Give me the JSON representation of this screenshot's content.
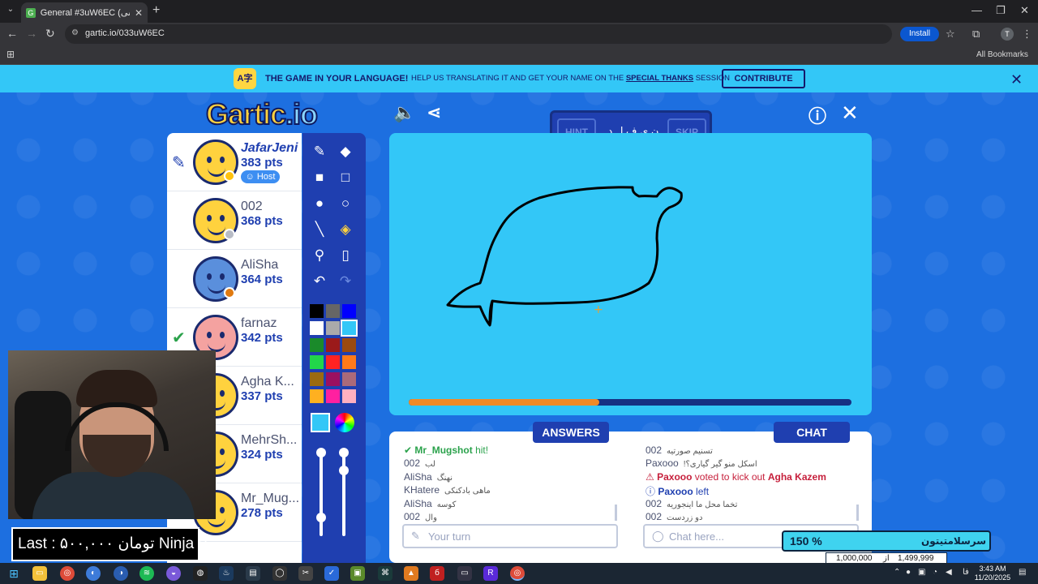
{
  "browser": {
    "tab_title": "General #3uW6EC (فارسی) - Gar",
    "url": "gartic.io/033uW6EC",
    "install_label": "Install",
    "bookmarks_label": "All Bookmarks",
    "profile_initial": "T"
  },
  "banner": {
    "headline": "THE GAME IN YOUR LANGUAGE!",
    "text_before": "HELP US TRANSLATING IT AND GET YOUR NAME ON THE",
    "link": "SPECIAL THANKS",
    "text_after": "SESSION",
    "contribute_label": "CONTRIBUTE"
  },
  "game": {
    "logo_main": "Gartic",
    "logo_tld": ".io",
    "hint_label": "HINT",
    "skip_label": "SKIP",
    "word_pattern": "ن ی ف ل د",
    "time_progress": 0.43
  },
  "players": [
    {
      "name": "JafarJeni",
      "points": "383 pts",
      "host_label": "Host",
      "status_color": "#ffc20e",
      "drawing": true
    },
    {
      "name": "002",
      "points": "368 pts",
      "status_color": "#b8bcc6"
    },
    {
      "name": "AliSha",
      "points": "364 pts",
      "status_color": "#e07a10"
    },
    {
      "name": "farnaz",
      "points": "342 pts",
      "guessed": true
    },
    {
      "name": "Agha K...",
      "points": "337 pts"
    },
    {
      "name": "MehrSh...",
      "points": "324 pts"
    },
    {
      "name": "Mr_Mug...",
      "points": "278 pts"
    }
  ],
  "palette": [
    "#000000",
    "#666666",
    "#0000ff",
    "#ffffff",
    "#aaaaaa",
    "#33c7f7",
    "#1a8a2a",
    "#9b1a1a",
    "#9b4a10",
    "#22d64a",
    "#ff2222",
    "#ff7a1a",
    "#9b6a10",
    "#9b1060",
    "#aa6a7a",
    "#ffb020",
    "#ff20a0",
    "#ffb0c0"
  ],
  "selected_color": "#33c7f7",
  "answers": {
    "tab_label": "ANSWERS",
    "messages": [
      {
        "type": "good",
        "user": "Mr_Mugshot",
        "text": "hit!"
      },
      {
        "user": "002",
        "text": "لب"
      },
      {
        "user": "AliSha",
        "text": "نهنگ"
      },
      {
        "user": "KHatere",
        "text": "ماهی بادکنکی"
      },
      {
        "user": "AliSha",
        "text": "کوسه"
      },
      {
        "user": "002",
        "text": "وال"
      }
    ],
    "placeholder": "Your turn"
  },
  "chat": {
    "tab_label": "CHAT",
    "messages": [
      {
        "user": "002",
        "text": "تسنیم صورتیه"
      },
      {
        "user": "Paxooo",
        "text": "!اسکل منو گیر گیاری؟"
      },
      {
        "type": "alert",
        "user": "Paxooo",
        "text": "voted to kick out",
        "target": "Agha Kazem"
      },
      {
        "type": "info",
        "user": "Paxooo",
        "text": "left"
      },
      {
        "user": "002",
        "text": "تخما محل ما اینجوریه"
      },
      {
        "user": "002",
        "text": "دو زردست"
      }
    ],
    "placeholder": "Chat here..."
  },
  "overlay": {
    "ninja_text": "Last : ۵۰۰,۰۰۰ تومان Ninja ;)",
    "donation_percent": "150 %",
    "donation_title": "سرسلامتیتون",
    "donation_current": "1,499,999",
    "donation_of": "از",
    "donation_goal": "1,000,000"
  },
  "taskbar": {
    "time": "3:43 AM",
    "date": "11/20/2025",
    "lang": "فا"
  }
}
